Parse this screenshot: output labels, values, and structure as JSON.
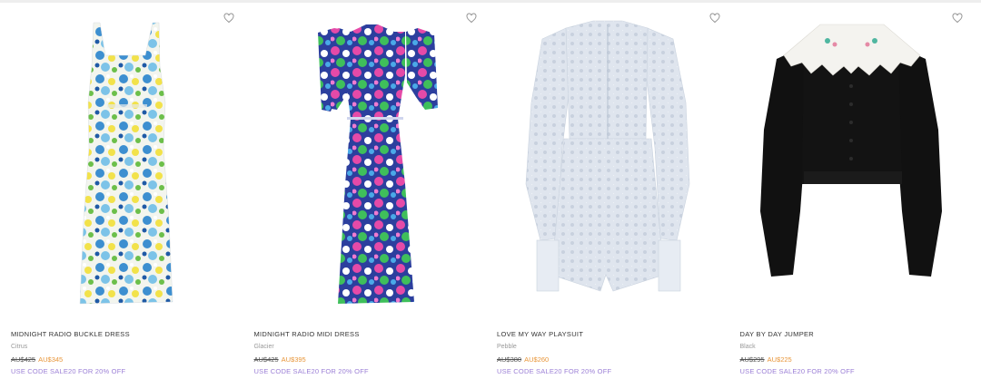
{
  "products": [
    {
      "name": "MIDNIGHT RADIO BUCKLE DRESS",
      "color": "Citrus",
      "original_price": "AU$425",
      "sale_price": "AU$345",
      "promo": "USE CODE SALE20 FOR 20% OFF",
      "icon": "heart-outline-icon"
    },
    {
      "name": "MIDNIGHT RADIO MIDI DRESS",
      "color": "Glacier",
      "original_price": "AU$425",
      "sale_price": "AU$395",
      "promo": "USE CODE SALE20 FOR 20% OFF",
      "icon": "heart-outline-icon"
    },
    {
      "name": "LOVE MY WAY PLAYSUIT",
      "color": "Pebble",
      "original_price": "AU$380",
      "sale_price": "AU$260",
      "promo": "USE CODE SALE20 FOR 20% OFF",
      "icon": "heart-outline-icon"
    },
    {
      "name": "DAY BY DAY JUMPER",
      "color": "Black",
      "original_price": "AU$295",
      "sale_price": "AU$225",
      "promo": "USE CODE SALE20 FOR 20% OFF",
      "icon": "heart-outline-icon"
    }
  ],
  "colors": {
    "sale_price": "#e8963a",
    "promo": "#9b7fd6",
    "color_label": "#9a9a9a"
  }
}
